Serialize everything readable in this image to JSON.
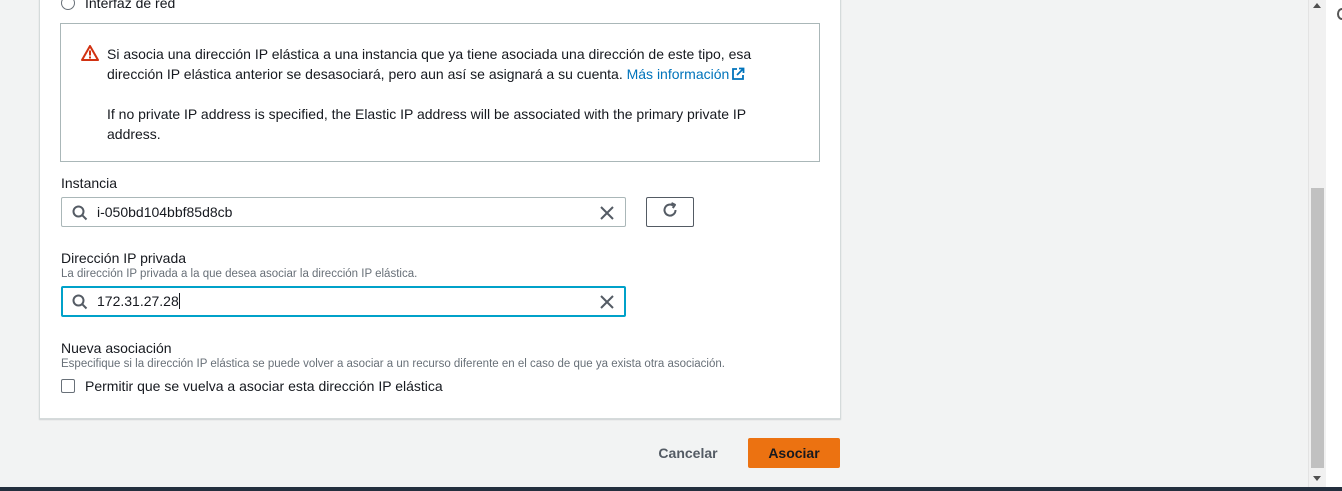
{
  "radio_option": {
    "label": "Interfaz de red",
    "selected": false
  },
  "alert": {
    "icon": "warning-icon",
    "text": "Si asocia una dirección IP elástica a una instancia que ya tiene asociada una dirección de este tipo, esa dirección IP elástica anterior se desasociará, pero aun así se asignará a su cuenta.",
    "link_label": "Más información",
    "link_icon": "external-link-icon",
    "text2": "If no private IP address is specified, the Elastic IP address will be associated with the primary private IP address."
  },
  "instance": {
    "label": "Instancia",
    "value": "i-050bd104bbf85d8cb",
    "search_icon": "search-icon",
    "clear_icon": "close-icon",
    "refresh_icon": "refresh-icon"
  },
  "private_ip": {
    "label": "Dirección IP privada",
    "description": "La dirección IP privada a la que desea asociar la dirección IP elástica.",
    "value": "172.31.27.28",
    "search_icon": "search-icon",
    "clear_icon": "close-icon"
  },
  "reassociation": {
    "label": "Nueva asociación",
    "description": "Especifique si la dirección IP elástica se puede volver a asociar a un recurso diferente en el caso de que ya exista otra asociación.",
    "checkbox_label": "Permitir que se vuelva a asociar esta dirección IP elástica",
    "checked": false
  },
  "actions": {
    "cancel_label": "Cancelar",
    "primary_label": "Asociar"
  },
  "colors": {
    "primary_button": "#ec7211",
    "link": "#0073bb",
    "focus_border": "#00a1c9",
    "warning_icon": "#d13212"
  }
}
